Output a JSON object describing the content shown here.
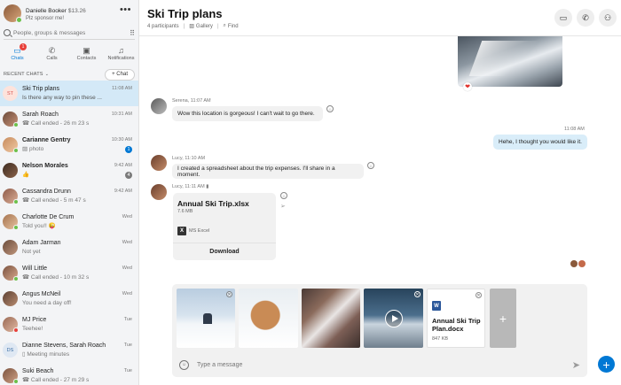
{
  "profile": {
    "name": "Danielle Booker",
    "credit": "$13.26",
    "status": "Plz sponsor me!"
  },
  "search": {
    "placeholder": "People, groups & messages"
  },
  "nav": {
    "tabs": [
      {
        "label": "Chats",
        "badge": "1",
        "icon": "chat-icon"
      },
      {
        "label": "Calls",
        "icon": "phone-icon"
      },
      {
        "label": "Contacts",
        "icon": "contacts-icon"
      },
      {
        "label": "Notifications",
        "icon": "bell-icon"
      }
    ]
  },
  "recent": {
    "label": "RECENT CHATS",
    "new_chat_label": "+ Chat"
  },
  "chats": [
    {
      "initials": "ST",
      "name": "Ski Trip plans",
      "preview": "Is there any way to pin these ...",
      "time": "11:08 AM"
    },
    {
      "name": "Sarah Roach",
      "preview": "Call ended - 26 m 23 s",
      "time": "10:31 AM"
    },
    {
      "name": "Carianne Gentry",
      "preview": "photo",
      "time": "10:30 AM",
      "unread": "1"
    },
    {
      "name": "Nelson Morales",
      "preview": "👍",
      "time": "9:42 AM",
      "unread": "4"
    },
    {
      "name": "Cassandra Drunn",
      "preview": "Call ended - 5 m 47 s",
      "time": "9:42 AM"
    },
    {
      "name": "Charlotte De Crum",
      "preview": "Told you!! 😜",
      "time": "Wed"
    },
    {
      "name": "Adam Jarman",
      "preview": "Not yet",
      "time": "Wed"
    },
    {
      "name": "Will Little",
      "preview": "Call ended - 10 m 32 s",
      "time": "Wed"
    },
    {
      "name": "Angus McNeil",
      "preview": "You need a day off!",
      "time": "Wed"
    },
    {
      "name": "MJ Price",
      "preview": "Teehee!",
      "time": "Tue"
    },
    {
      "initials": "DS",
      "name": "Dianne Stevens, Sarah Roach",
      "preview": "Meeting minutes",
      "time": "Tue"
    },
    {
      "name": "Suki Beach",
      "preview": "Call ended - 27 m 29 s",
      "time": "Tue"
    }
  ],
  "header": {
    "title": "Ski Trip plans",
    "participants": "4 participants",
    "gallery": "Gallery",
    "find": "Find"
  },
  "messages": {
    "serena": {
      "meta": "Serena, 11:07 AM",
      "text": "Wow this location is gorgeous! I can't wait to go there."
    },
    "me": {
      "meta": "11:08 AM",
      "text": "Hehe, I thought you would like it."
    },
    "lucy1": {
      "meta": "Lucy, 11:10 AM",
      "text": "I created a spreadsheet about the trip expenses. I'll share in a moment."
    },
    "lucy2": {
      "meta": "Lucy, 11:11 AM"
    },
    "file": {
      "name": "Annual Ski Trip.xlsx",
      "size": "7.6 MB",
      "app": "MS Excel",
      "download": "Download"
    }
  },
  "composer": {
    "doc_name": "Annual Ski Trip Plan.docx",
    "doc_size": "847 KB",
    "placeholder": "Type a message"
  },
  "colors": {
    "accent": "#0078d4",
    "selected": "#d4e9f7",
    "outgoing": "#d9edf9",
    "online": "#6cc04a",
    "busy": "#e8403a"
  }
}
